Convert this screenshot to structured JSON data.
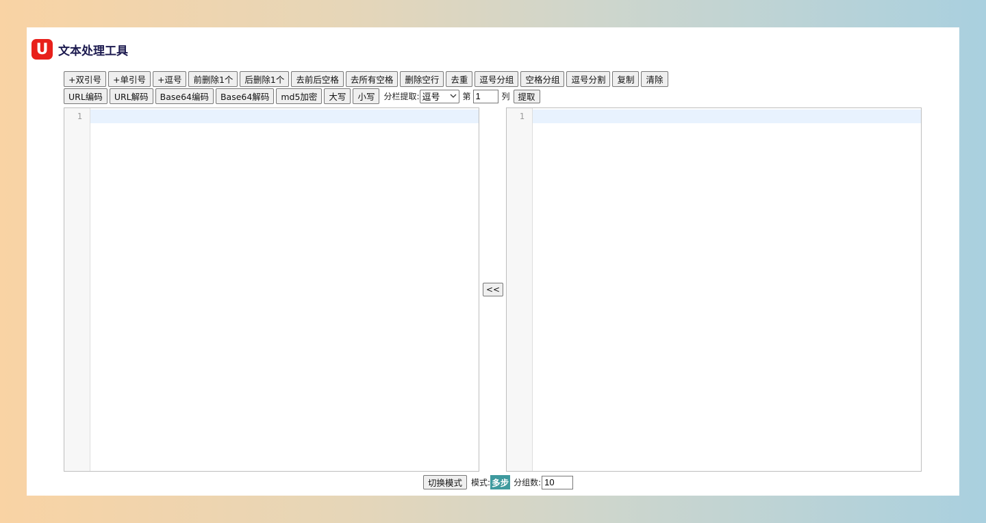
{
  "app": {
    "logo_letter": "U",
    "title": "文本处理工具"
  },
  "toolbar_row1": [
    "+双引号",
    "+单引号",
    "+逗号",
    "前删除1个",
    "后删除1个",
    "去前后空格",
    "去所有空格",
    "删除空行",
    "去重",
    "逗号分组",
    "空格分组",
    "逗号分割",
    "复制",
    "清除"
  ],
  "toolbar_row2": [
    "URL编码",
    "URL解码",
    "Base64编码",
    "Base64解码",
    "md5加密",
    "大写",
    "小写"
  ],
  "extract": {
    "label": "分栏提取:",
    "selected": "逗号",
    "col_prefix": "第",
    "col_value": "1",
    "col_suffix": "列",
    "button": "提取"
  },
  "editors": {
    "left": {
      "line_numbers": [
        "1"
      ]
    },
    "right": {
      "line_numbers": [
        "1"
      ]
    }
  },
  "swap_label": "<<",
  "bottom": {
    "toggle_label": "切换模式",
    "mode_label": "模式:",
    "mode_value": "多步",
    "group_label": "分组数:",
    "group_value": "10"
  }
}
